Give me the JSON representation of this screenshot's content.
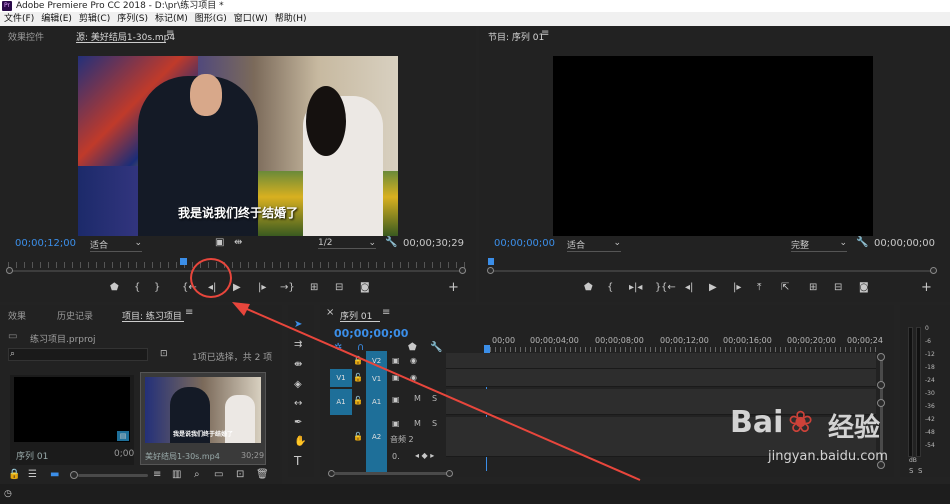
{
  "app": {
    "title": "Adobe Premiere Pro CC 2018 - D:\\pr\\练习项目 *",
    "logo": "Pr"
  },
  "menu": [
    "文件(F)",
    "编辑(E)",
    "剪辑(C)",
    "序列(S)",
    "标记(M)",
    "图形(G)",
    "窗口(W)",
    "帮助(H)"
  ],
  "source": {
    "tab_effects": "效果控件",
    "tab_source": "源: 美好结局1-30s.mp4",
    "subtitle": "我是说我们终于结婚了",
    "timecode": "00;00;12;00",
    "fit": "适合",
    "resolution": "1/2",
    "duration": "00;00;30;29"
  },
  "program": {
    "tab": "节目: 序列 01",
    "timecode": "00;00;00;00",
    "fit": "适合",
    "quality": "完整",
    "duration": "00;00;00;00"
  },
  "project": {
    "tab_effects": "效果",
    "tab_history": "历史记录",
    "tab_project": "项目: 练习项目",
    "file": "练习项目.prproj",
    "selection": "1项已选择，共 2 项",
    "items": [
      {
        "name": "序列 01",
        "dur": "0;00"
      },
      {
        "name": "美好结局1-30s.mp4",
        "dur": "30;29",
        "thumb_text": "我是说我们终于结婚了"
      }
    ]
  },
  "timeline": {
    "tab": "序列 01",
    "timecode": "00;00;00;00",
    "ruler": [
      "00;00",
      "00;00;04;00",
      "00;00;08;00",
      "00;00;12;00",
      "00;00;16;00",
      "00;00;20;00",
      "00;00;24"
    ],
    "tracks": {
      "v2": "V2",
      "v1": "V1",
      "a1": "A1",
      "a2": "A2",
      "v1src": "V1",
      "a1src": "A1",
      "audio2": "音频 2",
      "m": "M",
      "s": "S",
      "o": "0."
    }
  },
  "meter": {
    "labels": [
      "0",
      "-6",
      "-12",
      "-18",
      "-24",
      "-30",
      "-36",
      "-42",
      "-48",
      "-54"
    ],
    "db": "dB",
    "s1": "S",
    "s2": "S"
  },
  "watermark": {
    "brand": "Bai",
    "brand2": "经验",
    "url": "jingyan.baidu.com"
  },
  "colors": {
    "accent": "#3b8ee8",
    "annotation": "#e8463c",
    "track_tag": "#1e6f99"
  }
}
